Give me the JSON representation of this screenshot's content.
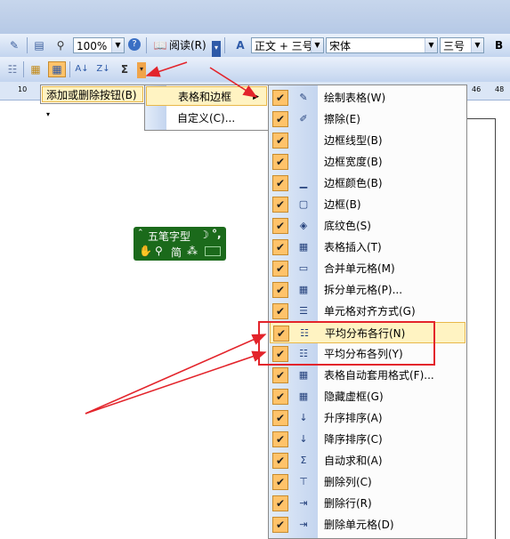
{
  "toolbar1": {
    "zoom": "100%",
    "read_label": "阅读(R)",
    "style_value": "正文 + 三号",
    "font_value": "宋体",
    "size_value": "三号",
    "bold_label": "B"
  },
  "toolbar2": {
    "sum_symbol": "Σ"
  },
  "ruler": {
    "num_left": "10",
    "num_right": "46",
    "num_far_right": "48"
  },
  "menu_add_remove": {
    "label": "添加或删除按钮(B)"
  },
  "submenu": {
    "items": [
      {
        "label": "表格和边框"
      },
      {
        "label": "自定义(C)..."
      }
    ]
  },
  "buttons_menu": {
    "items": [
      {
        "label": "绘制表格(W)",
        "icon": "pencil-icon"
      },
      {
        "label": "擦除(E)",
        "icon": "eraser-icon"
      },
      {
        "label": "边框线型(B)",
        "icon": ""
      },
      {
        "label": "边框宽度(B)",
        "icon": ""
      },
      {
        "label": "边框颜色(B)",
        "icon": "pen-color-icon"
      },
      {
        "label": "边框(B)",
        "icon": "border-icon"
      },
      {
        "label": "底纹色(S)",
        "icon": "fill-bucket-icon"
      },
      {
        "label": "表格插入(T)",
        "icon": "insert-table-icon"
      },
      {
        "label": "合并单元格(M)",
        "icon": "merge-cells-icon"
      },
      {
        "label": "拆分单元格(P)...",
        "icon": "split-cells-icon"
      },
      {
        "label": "单元格对齐方式(G)",
        "icon": "align-icon"
      },
      {
        "label": "平均分布各行(N)",
        "icon": "distribute-rows-icon"
      },
      {
        "label": "平均分布各列(Y)",
        "icon": "distribute-columns-icon"
      },
      {
        "label": "表格自动套用格式(F)...",
        "icon": "autoformat-icon"
      },
      {
        "label": "隐藏虚框(G)",
        "icon": "gridlines-icon"
      },
      {
        "label": "升序排序(A)",
        "icon": "sort-ascending-icon"
      },
      {
        "label": "降序排序(C)",
        "icon": "sort-descending-icon"
      },
      {
        "label": "自动求和(A)",
        "icon": "autosum-icon"
      },
      {
        "label": "删除列(C)",
        "icon": "delete-column-icon"
      },
      {
        "label": "删除行(R)",
        "icon": "delete-row-icon"
      },
      {
        "label": "删除单元格(D)",
        "icon": "delete-cell-icon"
      }
    ]
  },
  "ime_bar": {
    "title": "五笔字型",
    "mode_jian": "简",
    "mode_dotted": "⁂"
  },
  "colors": {
    "highlight": "#fff3c2",
    "check": "#ffc36a",
    "annotation": "#e3242b",
    "ime_green": "#1b6a1b"
  }
}
